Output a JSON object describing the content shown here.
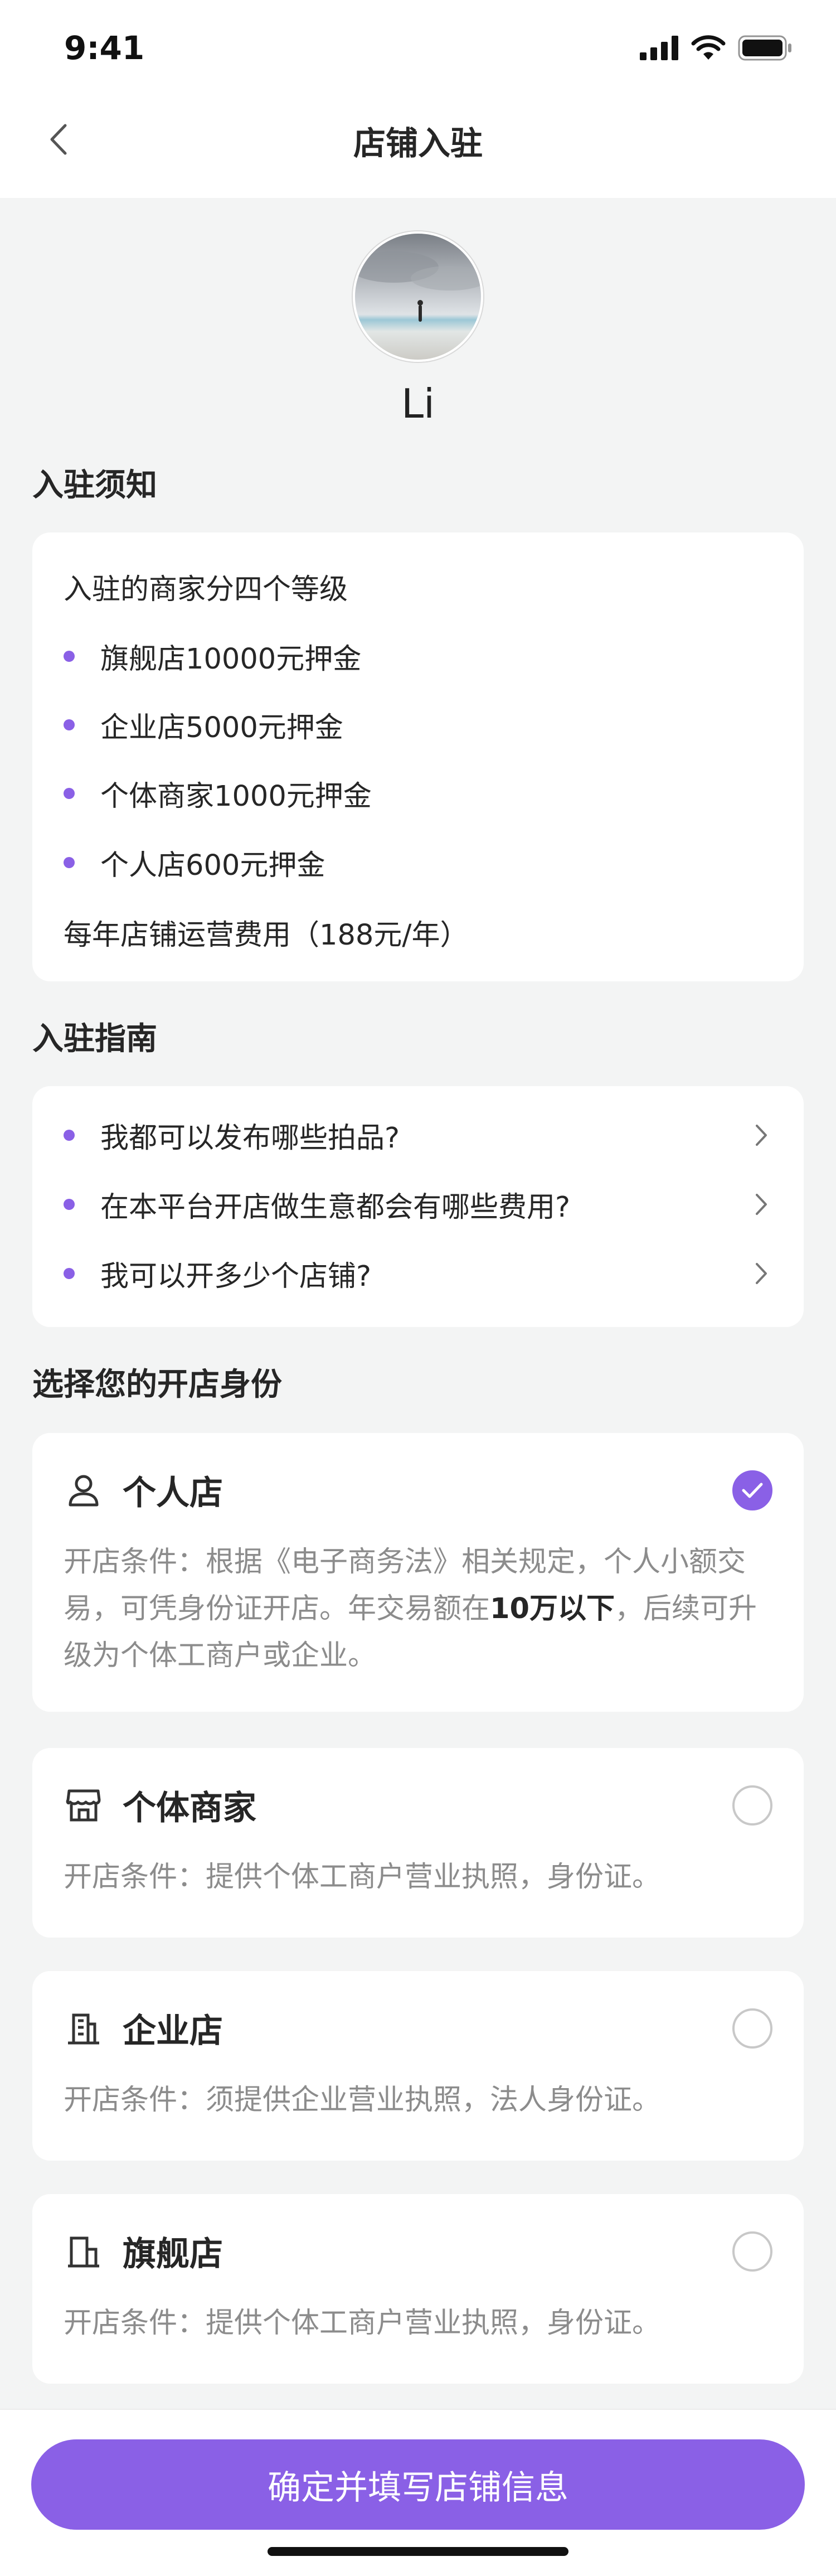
{
  "status_bar": {
    "time": "9:41"
  },
  "nav": {
    "title": "店铺入驻"
  },
  "profile": {
    "name": "Li"
  },
  "notice": {
    "title": "入驻须知",
    "intro": "入驻的商家分四个等级",
    "levels": [
      "旗舰店10000元押金",
      "企业店5000元押金",
      "个体商家1000元押金",
      "个人店600元押金"
    ],
    "annual_fee": "每年店铺运营费用（188元/年）"
  },
  "guide": {
    "title": "入驻指南",
    "items": [
      "我都可以发布哪些拍品?",
      "在本平台开店做生意都会有哪些费用?",
      "我可以开多少个店铺?"
    ]
  },
  "identity": {
    "title": "选择您的开店身份",
    "options": [
      {
        "name": "个人店",
        "icon": "person-icon",
        "selected": true,
        "desc_a": "开店条件：根据《电子商务法》相关规定，个人小额交易，可凭身份证开店。年交易额在",
        "desc_highlight": "10万以下",
        "desc_b": "，后续可升级为个体工商户或企业。"
      },
      {
        "name": "个体商家",
        "icon": "storefront-icon",
        "selected": false,
        "desc": "开店条件：提供个体工商户营业执照，身份证。"
      },
      {
        "name": "企业店",
        "icon": "office-building-icon",
        "selected": false,
        "desc": "开店条件：须提供企业营业执照，法人身份证。"
      },
      {
        "name": "旗舰店",
        "icon": "flagship-building-icon",
        "selected": false,
        "desc": "开店条件：提供个体工商户营业执照，身份证。"
      }
    ]
  },
  "footer": {
    "submit_label": "确定并填写店铺信息"
  },
  "colors": {
    "accent": "#8a60e6",
    "background": "#f3f4f4",
    "card": "#ffffff",
    "muted_text": "#8c8c8c"
  }
}
